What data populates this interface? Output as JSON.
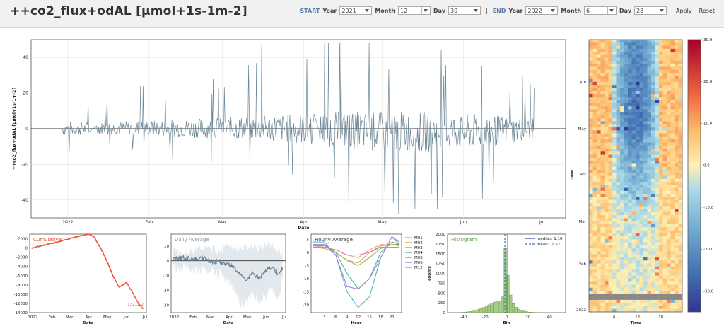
{
  "header": {
    "title": "++co2_flux+odAL [µmol+1s-1m-2]",
    "start_label": "START",
    "end_label": "END",
    "separator": "|",
    "year_label": "Year",
    "month_label": "Month",
    "day_label": "Day",
    "start_year": "2021",
    "start_month": "12",
    "start_day": "30",
    "end_year": "2022",
    "end_month": "6",
    "end_day": "28",
    "apply_label": "Apply",
    "reset_label": "Reset"
  },
  "chart_data": [
    {
      "id": "timeseries",
      "type": "line",
      "ylabel": "++co2_flux+odAL [µmol+1s-1m-2]",
      "xlabel": "Date",
      "ylim": [
        -50,
        50
      ],
      "yticks": [
        -40,
        -20,
        0,
        20,
        40
      ],
      "xticks": [
        "2022",
        "Feb",
        "Mar",
        "Apr",
        "May",
        "Jun",
        "Jul"
      ],
      "series_color": "#6c8796",
      "approx_daily_envelope": {
        "dates": [
          "2021-12-30",
          "2022-01-15",
          "2022-02-01",
          "2022-02-15",
          "2022-03-01",
          "2022-03-15",
          "2022-04-01",
          "2022-04-15",
          "2022-05-01",
          "2022-05-15",
          "2022-06-01",
          "2022-06-15",
          "2022-06-28"
        ],
        "upper": [
          10,
          10,
          12,
          14,
          16,
          20,
          22,
          24,
          22,
          22,
          20,
          18,
          14
        ],
        "lower": [
          -10,
          -8,
          -10,
          -12,
          -14,
          -16,
          -22,
          -28,
          -34,
          -36,
          -30,
          -26,
          -14
        ]
      }
    },
    {
      "id": "cumulative",
      "type": "line",
      "title": "Cumulative",
      "xlabel": "Date",
      "ylim": [
        -14000,
        3000
      ],
      "yticks": [
        2000,
        0,
        -2000,
        -4000,
        -6000,
        -8000,
        -10000,
        -12000,
        -14000
      ],
      "xticks": [
        "2022",
        "Feb",
        "Mar",
        "Apr",
        "May",
        "Jun",
        "Jul"
      ],
      "x": [
        "2021-12-30",
        "2022-01-15",
        "2022-02-01",
        "2022-02-15",
        "2022-03-01",
        "2022-03-15",
        "2022-04-01",
        "2022-04-10",
        "2022-04-20",
        "2022-05-01",
        "2022-05-10",
        "2022-05-20",
        "2022-06-01",
        "2022-06-10",
        "2022-06-20",
        "2022-06-28"
      ],
      "y": [
        0,
        500,
        1000,
        1500,
        2000,
        2500,
        3000,
        2400,
        0,
        -3000,
        -6000,
        -8500,
        -7500,
        -9500,
        -12000,
        -13212
      ],
      "end_label": "-13212.2",
      "color": "#f0553a"
    },
    {
      "id": "daily_average",
      "type": "area",
      "title": "Daily Average",
      "xlabel": "Date",
      "ylim": [
        -35,
        18
      ],
      "yticks": [
        10,
        0,
        -10,
        -20,
        -30
      ],
      "xticks": [
        "2022",
        "Feb",
        "Mar",
        "Apr",
        "May",
        "Jun",
        "Jul"
      ],
      "x": [
        "2021-12-30",
        "2022-01-15",
        "2022-02-01",
        "2022-02-15",
        "2022-03-01",
        "2022-03-15",
        "2022-04-01",
        "2022-04-10",
        "2022-04-20",
        "2022-05-01",
        "2022-05-10",
        "2022-05-20",
        "2022-06-01",
        "2022-06-10",
        "2022-06-20",
        "2022-06-28"
      ],
      "mean": [
        1,
        2,
        1,
        2,
        0,
        -1,
        -2,
        -5,
        -10,
        -13,
        -8,
        -12,
        -6,
        -4,
        -9,
        -5
      ],
      "upper": [
        7,
        6,
        6,
        9,
        8,
        7,
        10,
        8,
        8,
        9,
        10,
        8,
        12,
        10,
        8,
        5
      ],
      "lower": [
        -4,
        -4,
        -5,
        -6,
        -8,
        -9,
        -14,
        -22,
        -30,
        -28,
        -20,
        -30,
        -24,
        -18,
        -28,
        -12
      ],
      "color": "#6a8694"
    },
    {
      "id": "hourly_average",
      "type": "line",
      "title": "Hourly Average",
      "xlabel": "Hour",
      "ylim": [
        -23,
        7
      ],
      "yticks": [
        5,
        0,
        -5,
        -10,
        -15,
        -20
      ],
      "xticks": [
        3,
        6,
        9,
        12,
        15,
        18,
        21
      ],
      "x": [
        0,
        3,
        6,
        9,
        12,
        15,
        18,
        21,
        23
      ],
      "series": [
        {
          "name": "M01",
          "color": "#f2a08f",
          "values": [
            2.5,
            2,
            1,
            -1,
            -2,
            1,
            3,
            3,
            3
          ]
        },
        {
          "name": "M02",
          "color": "#d9a04c",
          "values": [
            2,
            1.5,
            0,
            -3,
            -4,
            0,
            2.5,
            3,
            2.5
          ]
        },
        {
          "name": "M03",
          "color": "#9fb04a",
          "values": [
            2.5,
            2.5,
            0,
            -3,
            -5,
            -2,
            1.5,
            3,
            3
          ]
        },
        {
          "name": "M04",
          "color": "#4cb88a",
          "values": [
            3,
            3,
            0,
            -8,
            -14,
            -10,
            0,
            4,
            3
          ]
        },
        {
          "name": "M05",
          "color": "#56b4c9",
          "values": [
            4,
            4,
            -1,
            -15,
            -21,
            -17,
            -2,
            6,
            4
          ]
        },
        {
          "name": "M06",
          "color": "#a07ee0",
          "values": [
            3,
            3,
            -1,
            -13,
            -14,
            -10,
            -2,
            6,
            3
          ]
        },
        {
          "name": "M12",
          "color": "#e27ab8",
          "values": [
            2,
            2,
            1,
            -1,
            -1,
            0,
            2,
            2,
            2
          ]
        }
      ]
    },
    {
      "id": "histogram",
      "type": "bar",
      "title": "Histogram",
      "xlabel": "Bin",
      "ylabel": "counts",
      "ylim": [
        0,
        2000
      ],
      "yticks": [
        0,
        250,
        500,
        750,
        1000,
        1250,
        1500,
        1750,
        2000
      ],
      "xticks": [
        -40,
        -20,
        0,
        20,
        40
      ],
      "bin_width": 2.5,
      "bins_start": -50,
      "values": [
        0,
        0,
        0,
        5,
        10,
        20,
        30,
        40,
        60,
        80,
        100,
        130,
        170,
        200,
        240,
        270,
        280,
        300,
        400,
        1650,
        950,
        450,
        230,
        140,
        90,
        55,
        40,
        25,
        15,
        10,
        5,
        5,
        0,
        0,
        0,
        0,
        0,
        0,
        0,
        0
      ],
      "median": 1.1,
      "mean": -1.57,
      "legend": [
        "median: 1.10",
        "mean: -1.57"
      ],
      "legend_position": "top-right",
      "color": "#a8cc8c"
    },
    {
      "id": "heatmap",
      "type": "heatmap",
      "xlabel": "Time",
      "ylabel": "Date",
      "xticks": [
        6,
        12,
        18
      ],
      "yticks": [
        "2022",
        "Feb",
        "Mar",
        "Apr",
        "May",
        "Jun"
      ],
      "colorbar_ticks": [
        30,
        20,
        10,
        0,
        -10,
        -20,
        -30
      ],
      "colorbar_range": [
        -35,
        30
      ],
      "colormap": "RdYlBu_r"
    }
  ]
}
